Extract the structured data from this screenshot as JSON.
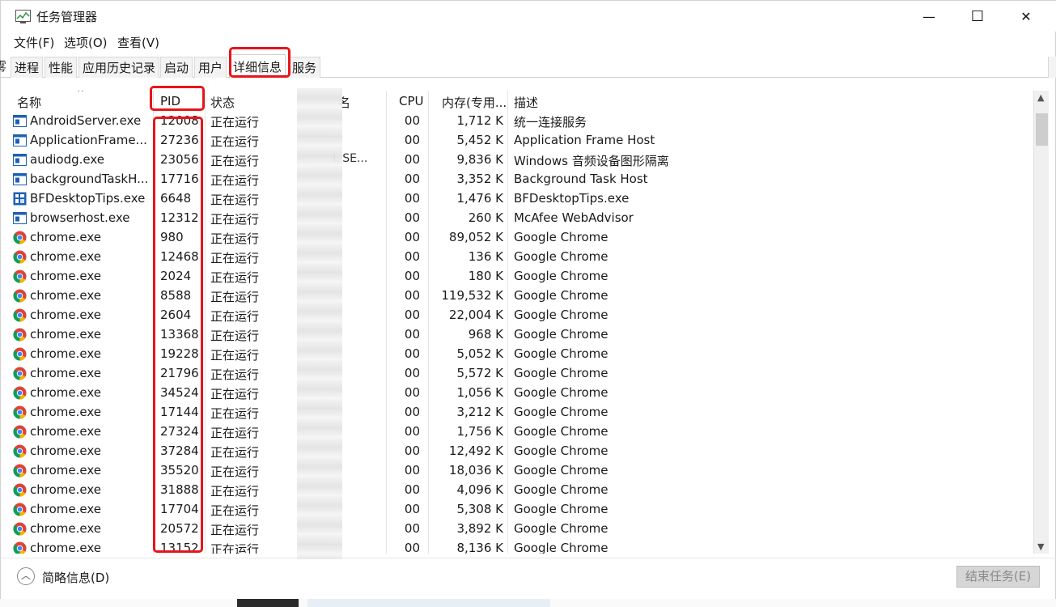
{
  "window": {
    "title": "任务管理器"
  },
  "controls": {
    "minimize": "—",
    "maximize": "☐",
    "close": "✕"
  },
  "menu": [
    "文件(F)",
    "选项(O)",
    "查看(V)"
  ],
  "tabs": [
    "进程",
    "性能",
    "应用历史记录",
    "启动",
    "用户",
    "详细信息",
    "服务"
  ],
  "active_tab": "详细信息",
  "tab_left_fragment": "雾",
  "columns": {
    "name": "名称",
    "pid": "PID",
    "status": "状态",
    "user": "名",
    "cpu": "CPU",
    "memory": "内存(专用...",
    "description": "描述"
  },
  "rows": [
    {
      "icon": "app-window-icon",
      "name": "AndroidServer.exe",
      "pid": "12008",
      "status": "正在运行",
      "user": "",
      "cpu": "00",
      "memory": "1,712 K",
      "description": "统一连接服务"
    },
    {
      "icon": "app-window-icon",
      "name": "ApplicationFrame...",
      "pid": "27236",
      "status": "正在运行",
      "user": "",
      "cpu": "00",
      "memory": "5,452 K",
      "description": "Application Frame Host"
    },
    {
      "icon": "app-window-icon",
      "name": "audiodg.exe",
      "pid": "23056",
      "status": "正在运行",
      "user": "L SE...",
      "cpu": "00",
      "memory": "9,836 K",
      "description": "Windows 音频设备图形隔离"
    },
    {
      "icon": "app-window-icon",
      "name": "backgroundTaskH...",
      "pid": "17716",
      "status": "正在运行",
      "user": "",
      "cpu": "00",
      "memory": "3,352 K",
      "description": "Background Task Host"
    },
    {
      "icon": "tips-icon",
      "name": "BFDesktopTips.exe",
      "pid": "6648",
      "status": "正在运行",
      "user": "",
      "cpu": "00",
      "memory": "1,476 K",
      "description": "BFDesktopTips.exe"
    },
    {
      "icon": "app-window-icon",
      "name": "browserhost.exe",
      "pid": "12312",
      "status": "正在运行",
      "user": "",
      "cpu": "00",
      "memory": "260 K",
      "description": "McAfee WebAdvisor"
    },
    {
      "icon": "chrome-icon",
      "name": "chrome.exe",
      "pid": "980",
      "status": "正在运行",
      "user": "",
      "cpu": "00",
      "memory": "89,052 K",
      "description": "Google Chrome"
    },
    {
      "icon": "chrome-icon",
      "name": "chrome.exe",
      "pid": "12468",
      "status": "正在运行",
      "user": "",
      "cpu": "00",
      "memory": "136 K",
      "description": "Google Chrome"
    },
    {
      "icon": "chrome-icon",
      "name": "chrome.exe",
      "pid": "2024",
      "status": "正在运行",
      "user": "",
      "cpu": "00",
      "memory": "180 K",
      "description": "Google Chrome"
    },
    {
      "icon": "chrome-icon",
      "name": "chrome.exe",
      "pid": "8588",
      "status": "正在运行",
      "user": "",
      "cpu": "00",
      "memory": "119,532 K",
      "description": "Google Chrome"
    },
    {
      "icon": "chrome-icon",
      "name": "chrome.exe",
      "pid": "2604",
      "status": "正在运行",
      "user": "",
      "cpu": "00",
      "memory": "22,004 K",
      "description": "Google Chrome"
    },
    {
      "icon": "chrome-icon",
      "name": "chrome.exe",
      "pid": "13368",
      "status": "正在运行",
      "user": "",
      "cpu": "00",
      "memory": "968 K",
      "description": "Google Chrome"
    },
    {
      "icon": "chrome-icon",
      "name": "chrome.exe",
      "pid": "19228",
      "status": "正在运行",
      "user": "",
      "cpu": "00",
      "memory": "5,052 K",
      "description": "Google Chrome"
    },
    {
      "icon": "chrome-icon",
      "name": "chrome.exe",
      "pid": "21796",
      "status": "正在运行",
      "user": "",
      "cpu": "00",
      "memory": "5,572 K",
      "description": "Google Chrome"
    },
    {
      "icon": "chrome-icon",
      "name": "chrome.exe",
      "pid": "34524",
      "status": "正在运行",
      "user": "",
      "cpu": "00",
      "memory": "1,056 K",
      "description": "Google Chrome"
    },
    {
      "icon": "chrome-icon",
      "name": "chrome.exe",
      "pid": "17144",
      "status": "正在运行",
      "user": "",
      "cpu": "00",
      "memory": "3,212 K",
      "description": "Google Chrome"
    },
    {
      "icon": "chrome-icon",
      "name": "chrome.exe",
      "pid": "27324",
      "status": "正在运行",
      "user": "",
      "cpu": "00",
      "memory": "1,756 K",
      "description": "Google Chrome"
    },
    {
      "icon": "chrome-icon",
      "name": "chrome.exe",
      "pid": "37284",
      "status": "正在运行",
      "user": "",
      "cpu": "00",
      "memory": "12,492 K",
      "description": "Google Chrome"
    },
    {
      "icon": "chrome-icon",
      "name": "chrome.exe",
      "pid": "35520",
      "status": "正在运行",
      "user": "",
      "cpu": "00",
      "memory": "18,036 K",
      "description": "Google Chrome"
    },
    {
      "icon": "chrome-icon",
      "name": "chrome.exe",
      "pid": "31888",
      "status": "正在运行",
      "user": "",
      "cpu": "00",
      "memory": "4,096 K",
      "description": "Google Chrome"
    },
    {
      "icon": "chrome-icon",
      "name": "chrome.exe",
      "pid": "17704",
      "status": "正在运行",
      "user": "",
      "cpu": "00",
      "memory": "5,308 K",
      "description": "Google Chrome"
    },
    {
      "icon": "chrome-icon",
      "name": "chrome.exe",
      "pid": "20572",
      "status": "正在运行",
      "user": "",
      "cpu": "00",
      "memory": "3,892 K",
      "description": "Google Chrome"
    },
    {
      "icon": "chrome-icon",
      "name": "chrome.exe",
      "pid": "13152",
      "status": "正在运行",
      "user": "",
      "cpu": "00",
      "memory": "8,136 K",
      "description": "Google Chrome"
    }
  ],
  "footer": {
    "collapse_label": "简略信息(D)",
    "end_task": "结束任务(E)"
  },
  "colors": {
    "annotation": "#e8141b",
    "chrome_red": "#db4437",
    "chrome_green": "#0f9d58",
    "chrome_yellow": "#f4b400",
    "chrome_blue": "#4285f4",
    "app_icon_blue": "#1f5fb4"
  }
}
